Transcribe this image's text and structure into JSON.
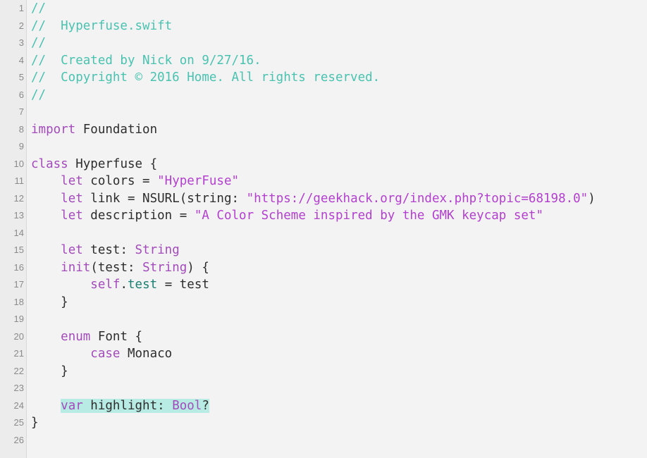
{
  "editor": {
    "colors": {
      "background": "#f3f3f3",
      "comment": "#49c2b0",
      "keyword": "#a34bbb",
      "string": "#b23fce",
      "property": "#1c7f73",
      "plain": "#2d2d2d",
      "highlight": "#b7ebe3"
    },
    "lines": [
      {
        "n": "1",
        "tokens": [
          {
            "t": "//",
            "c": "cm"
          }
        ]
      },
      {
        "n": "2",
        "tokens": [
          {
            "t": "//  Hyperfuse.swift",
            "c": "cm"
          }
        ]
      },
      {
        "n": "3",
        "tokens": [
          {
            "t": "//",
            "c": "cm"
          }
        ]
      },
      {
        "n": "4",
        "tokens": [
          {
            "t": "//  Created by Nick on 9/27/16.",
            "c": "cm"
          }
        ]
      },
      {
        "n": "5",
        "tokens": [
          {
            "t": "//  Copyright © 2016 Home. All rights reserved.",
            "c": "cm"
          }
        ]
      },
      {
        "n": "6",
        "tokens": [
          {
            "t": "//",
            "c": "cm"
          }
        ]
      },
      {
        "n": "7",
        "tokens": []
      },
      {
        "n": "8",
        "tokens": [
          {
            "t": "import",
            "c": "kw"
          },
          {
            "t": " Foundation",
            "c": ""
          }
        ]
      },
      {
        "n": "9",
        "tokens": []
      },
      {
        "n": "10",
        "tokens": [
          {
            "t": "class",
            "c": "kw"
          },
          {
            "t": " Hyperfuse {",
            "c": ""
          }
        ]
      },
      {
        "n": "11",
        "tokens": [
          {
            "t": "    ",
            "c": ""
          },
          {
            "t": "let",
            "c": "kw"
          },
          {
            "t": " colors = ",
            "c": ""
          },
          {
            "t": "\"HyperFuse\"",
            "c": "st"
          }
        ]
      },
      {
        "n": "12",
        "tokens": [
          {
            "t": "    ",
            "c": ""
          },
          {
            "t": "let",
            "c": "kw"
          },
          {
            "t": " link = NSURL(string: ",
            "c": ""
          },
          {
            "t": "\"https://geekhack.org/index.php?topic=68198.0\"",
            "c": "st"
          },
          {
            "t": ")",
            "c": ""
          }
        ]
      },
      {
        "n": "13",
        "tokens": [
          {
            "t": "    ",
            "c": ""
          },
          {
            "t": "let",
            "c": "kw"
          },
          {
            "t": " description = ",
            "c": ""
          },
          {
            "t": "\"A Color Scheme inspired by the GMK keycap set\"",
            "c": "st"
          }
        ]
      },
      {
        "n": "14",
        "tokens": []
      },
      {
        "n": "15",
        "tokens": [
          {
            "t": "    ",
            "c": ""
          },
          {
            "t": "let",
            "c": "kw"
          },
          {
            "t": " test: ",
            "c": ""
          },
          {
            "t": "String",
            "c": "kw"
          }
        ]
      },
      {
        "n": "16",
        "tokens": [
          {
            "t": "    ",
            "c": ""
          },
          {
            "t": "init",
            "c": "kw"
          },
          {
            "t": "(test: ",
            "c": ""
          },
          {
            "t": "String",
            "c": "kw"
          },
          {
            "t": ") {",
            "c": ""
          }
        ]
      },
      {
        "n": "17",
        "tokens": [
          {
            "t": "        ",
            "c": ""
          },
          {
            "t": "self",
            "c": "kw"
          },
          {
            "t": ".",
            "c": ""
          },
          {
            "t": "test",
            "c": "pr"
          },
          {
            "t": " = test",
            "c": ""
          }
        ]
      },
      {
        "n": "18",
        "tokens": [
          {
            "t": "    }",
            "c": ""
          }
        ]
      },
      {
        "n": "19",
        "tokens": []
      },
      {
        "n": "20",
        "tokens": [
          {
            "t": "    ",
            "c": ""
          },
          {
            "t": "enum",
            "c": "kw"
          },
          {
            "t": " Font {",
            "c": ""
          }
        ]
      },
      {
        "n": "21",
        "tokens": [
          {
            "t": "        ",
            "c": ""
          },
          {
            "t": "case",
            "c": "kw"
          },
          {
            "t": " Monaco",
            "c": ""
          }
        ]
      },
      {
        "n": "22",
        "tokens": [
          {
            "t": "    }",
            "c": ""
          }
        ]
      },
      {
        "n": "23",
        "tokens": []
      },
      {
        "n": "24",
        "tokens": [
          {
            "t": "    ",
            "c": ""
          },
          {
            "t": "var",
            "c": "kw hl"
          },
          {
            "t": " highlight: ",
            "c": "hl"
          },
          {
            "t": "Bool",
            "c": "kw hl"
          },
          {
            "t": "?",
            "c": "hl"
          }
        ]
      },
      {
        "n": "25",
        "tokens": [
          {
            "t": "}",
            "c": ""
          }
        ]
      },
      {
        "n": "26",
        "tokens": []
      }
    ]
  }
}
